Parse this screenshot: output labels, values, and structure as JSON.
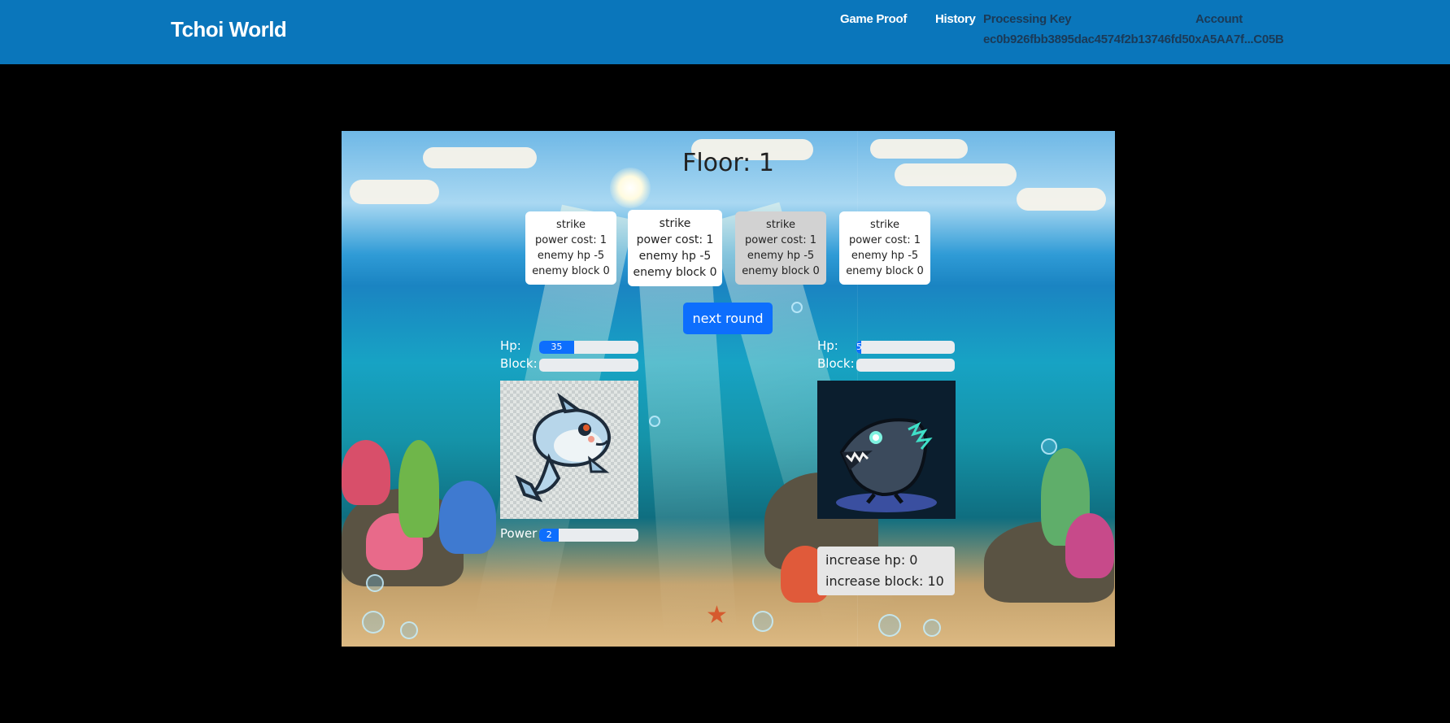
{
  "header": {
    "brand": "Tchoi World",
    "nav": {
      "game_proof": "Game Proof",
      "history": "History",
      "processing_key_label": "Processing Key",
      "processing_key_value": "ec0b926fbb3895dac4574f2b13746fd50xA5AA7f...C05B",
      "account": "Account"
    }
  },
  "game": {
    "floor_label": "Floor: 1",
    "cards": [
      {
        "name": "strike",
        "power_cost": "power cost: 1",
        "enemy_hp": "enemy hp -5",
        "enemy_block": "enemy block 0",
        "state": "normal"
      },
      {
        "name": "strike",
        "power_cost": "power cost: 1",
        "enemy_hp": "enemy hp -5",
        "enemy_block": "enemy block 0",
        "state": "hover"
      },
      {
        "name": "strike",
        "power_cost": "power cost: 1",
        "enemy_hp": "enemy hp -5",
        "enemy_block": "enemy block 0",
        "state": "disabled"
      },
      {
        "name": "strike",
        "power_cost": "power cost: 1",
        "enemy_hp": "enemy hp -5",
        "enemy_block": "enemy block 0",
        "state": "normal"
      }
    ],
    "next_round_label": "next round",
    "player": {
      "hp_label": "Hp:",
      "hp_value": "35",
      "hp_fraction": 0.35,
      "block_label": "Block:",
      "block_fraction": 0,
      "power_label": "Power",
      "power_value": "2",
      "power_fraction": 0.2,
      "portrait": "dolphin"
    },
    "enemy": {
      "hp_label": "Hp:",
      "hp_value": "5",
      "hp_fraction": 0.05,
      "block_label": "Block:",
      "block_fraction": 0,
      "portrait": "dark-shark",
      "intent": {
        "increase_hp": "increase hp: 0",
        "increase_block": "increase block: 10"
      }
    }
  },
  "colors": {
    "header_bg": "#0a76bb",
    "accent": "#0d6efd",
    "page_bg": "#000000"
  }
}
